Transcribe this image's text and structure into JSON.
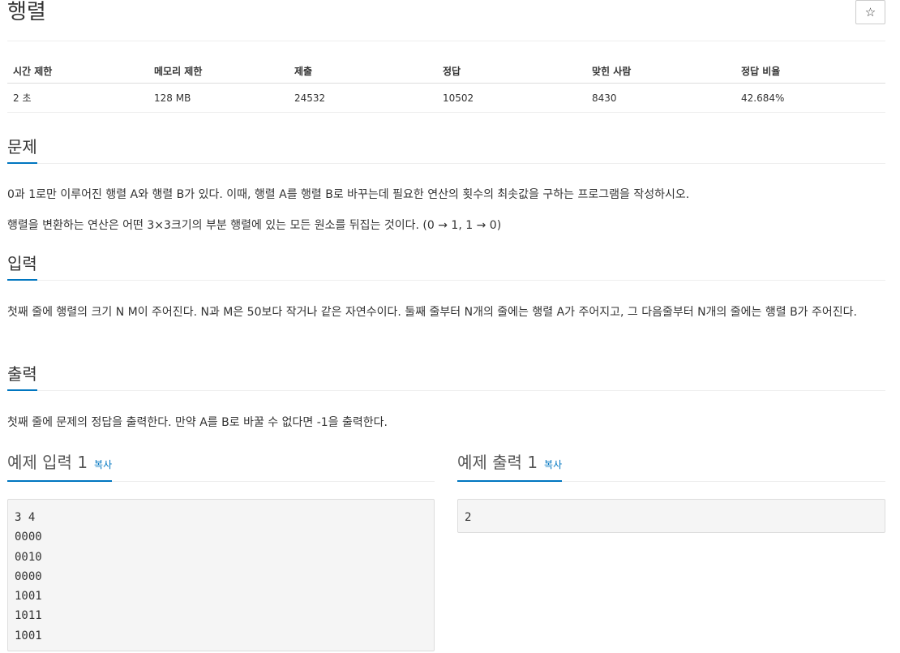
{
  "problem": {
    "title": "행렬",
    "star_icon": "☆"
  },
  "info_table": {
    "headers": [
      "시간 제한",
      "메모리 제한",
      "제출",
      "정답",
      "맞힌 사람",
      "정답 비율"
    ],
    "values": [
      "2 초",
      "128 MB",
      "24532",
      "10502",
      "8430",
      "42.684%"
    ]
  },
  "sections": {
    "description": {
      "heading": "문제",
      "paragraphs": [
        "0과 1로만 이루어진 행렬 A와 행렬 B가 있다. 이때, 행렬 A를 행렬 B로 바꾸는데 필요한 연산의 횟수의 최솟값을 구하는 프로그램을 작성하시오.",
        "행렬을 변환하는 연산은 어떤 3×3크기의 부분 행렬에 있는 모든 원소를 뒤집는 것이다. (0 → 1, 1 → 0)"
      ]
    },
    "input": {
      "heading": "입력",
      "text": "첫째 줄에 행렬의 크기 N M이 주어진다. N과 M은 50보다 작거나 같은 자연수이다. 둘째 줄부터 N개의 줄에는 행렬 A가 주어지고, 그 다음줄부터 N개의 줄에는 행렬 B가 주어진다."
    },
    "output": {
      "heading": "출력",
      "text": "첫째 줄에 문제의 정답을 출력한다. 만약 A를 B로 바꿀 수 없다면 -1을 출력한다."
    }
  },
  "samples": {
    "input": {
      "heading": "예제 입력 1",
      "copy_label": "복사",
      "content": "3 4\n0000\n0010\n0000\n1001\n1011\n1001"
    },
    "output": {
      "heading": "예제 출력 1",
      "copy_label": "복사",
      "content": "2"
    }
  }
}
